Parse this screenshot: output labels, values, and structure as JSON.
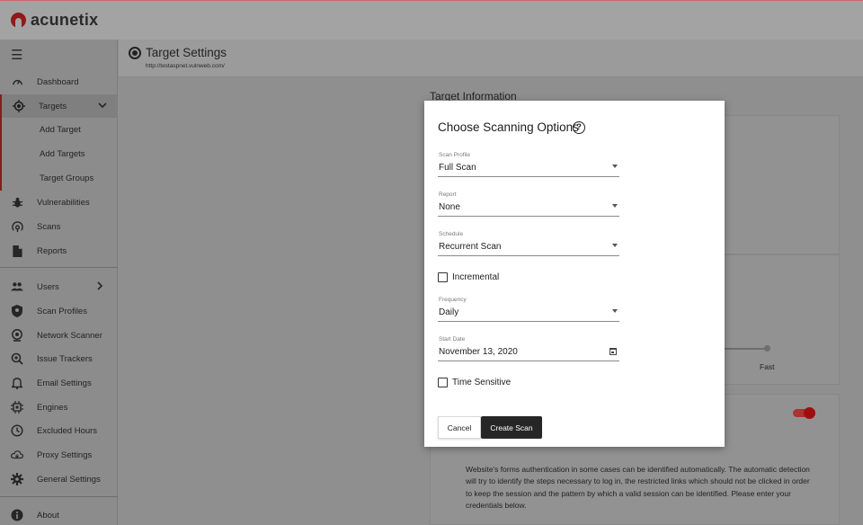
{
  "app": {
    "logo_text": "acunetix",
    "brand_color": "#b71c1c"
  },
  "sidebar": {
    "items": [
      {
        "label": "Dashboard",
        "icon": "dashboard-icon"
      },
      {
        "label": "Targets",
        "icon": "target-icon",
        "active": true,
        "expanded": true
      },
      {
        "label": "Vulnerabilities",
        "icon": "bug-icon"
      },
      {
        "label": "Scans",
        "icon": "radar-icon"
      },
      {
        "label": "Reports",
        "icon": "report-icon"
      },
      {
        "label": "Users",
        "icon": "users-icon"
      },
      {
        "label": "Scan Profiles",
        "icon": "shield-icon"
      },
      {
        "label": "Network Scanner",
        "icon": "network-scanner-icon"
      },
      {
        "label": "Issue Trackers",
        "icon": "issue-tracker-icon"
      },
      {
        "label": "Email Settings",
        "icon": "bell-icon"
      },
      {
        "label": "Engines",
        "icon": "chip-icon"
      },
      {
        "label": "Excluded Hours",
        "icon": "clock-icon"
      },
      {
        "label": "Proxy Settings",
        "icon": "cloud-icon"
      },
      {
        "label": "General Settings",
        "icon": "gear-icon"
      },
      {
        "label": "About",
        "icon": "info-icon"
      }
    ],
    "subitems": [
      {
        "label": "Add Target"
      },
      {
        "label": "Add Targets"
      },
      {
        "label": "Target Groups"
      }
    ]
  },
  "header": {
    "title": "Target Settings",
    "url": "http://testaspnet.vulnweb.com/"
  },
  "background": {
    "section_heading": "Target Information",
    "speed_label": "Fast",
    "description": "Website's forms authentication in some cases can be identified automatically. The automatic detection will try to identify the steps necessary to log in, the restricted links which should not be clicked in order to keep the session and the pattern by which a valid session can be identified. Please enter your credentials below."
  },
  "modal": {
    "title": "Choose Scanning Options",
    "fields": {
      "scan_profile": {
        "label": "Scan Profile",
        "value": "Full Scan"
      },
      "report": {
        "label": "Report",
        "value": "None"
      },
      "schedule": {
        "label": "Schedule",
        "value": "Recurrent Scan"
      },
      "frequency": {
        "label": "Frequency",
        "value": "Daily"
      },
      "start_date": {
        "label": "Start Date",
        "value": "November 13, 2020"
      }
    },
    "incremental_label": "Incremental",
    "incremental_checked": false,
    "time_sensitive_label": "Time Sensitive",
    "time_sensitive_checked": false,
    "cancel_label": "Cancel",
    "create_label": "Create Scan"
  }
}
